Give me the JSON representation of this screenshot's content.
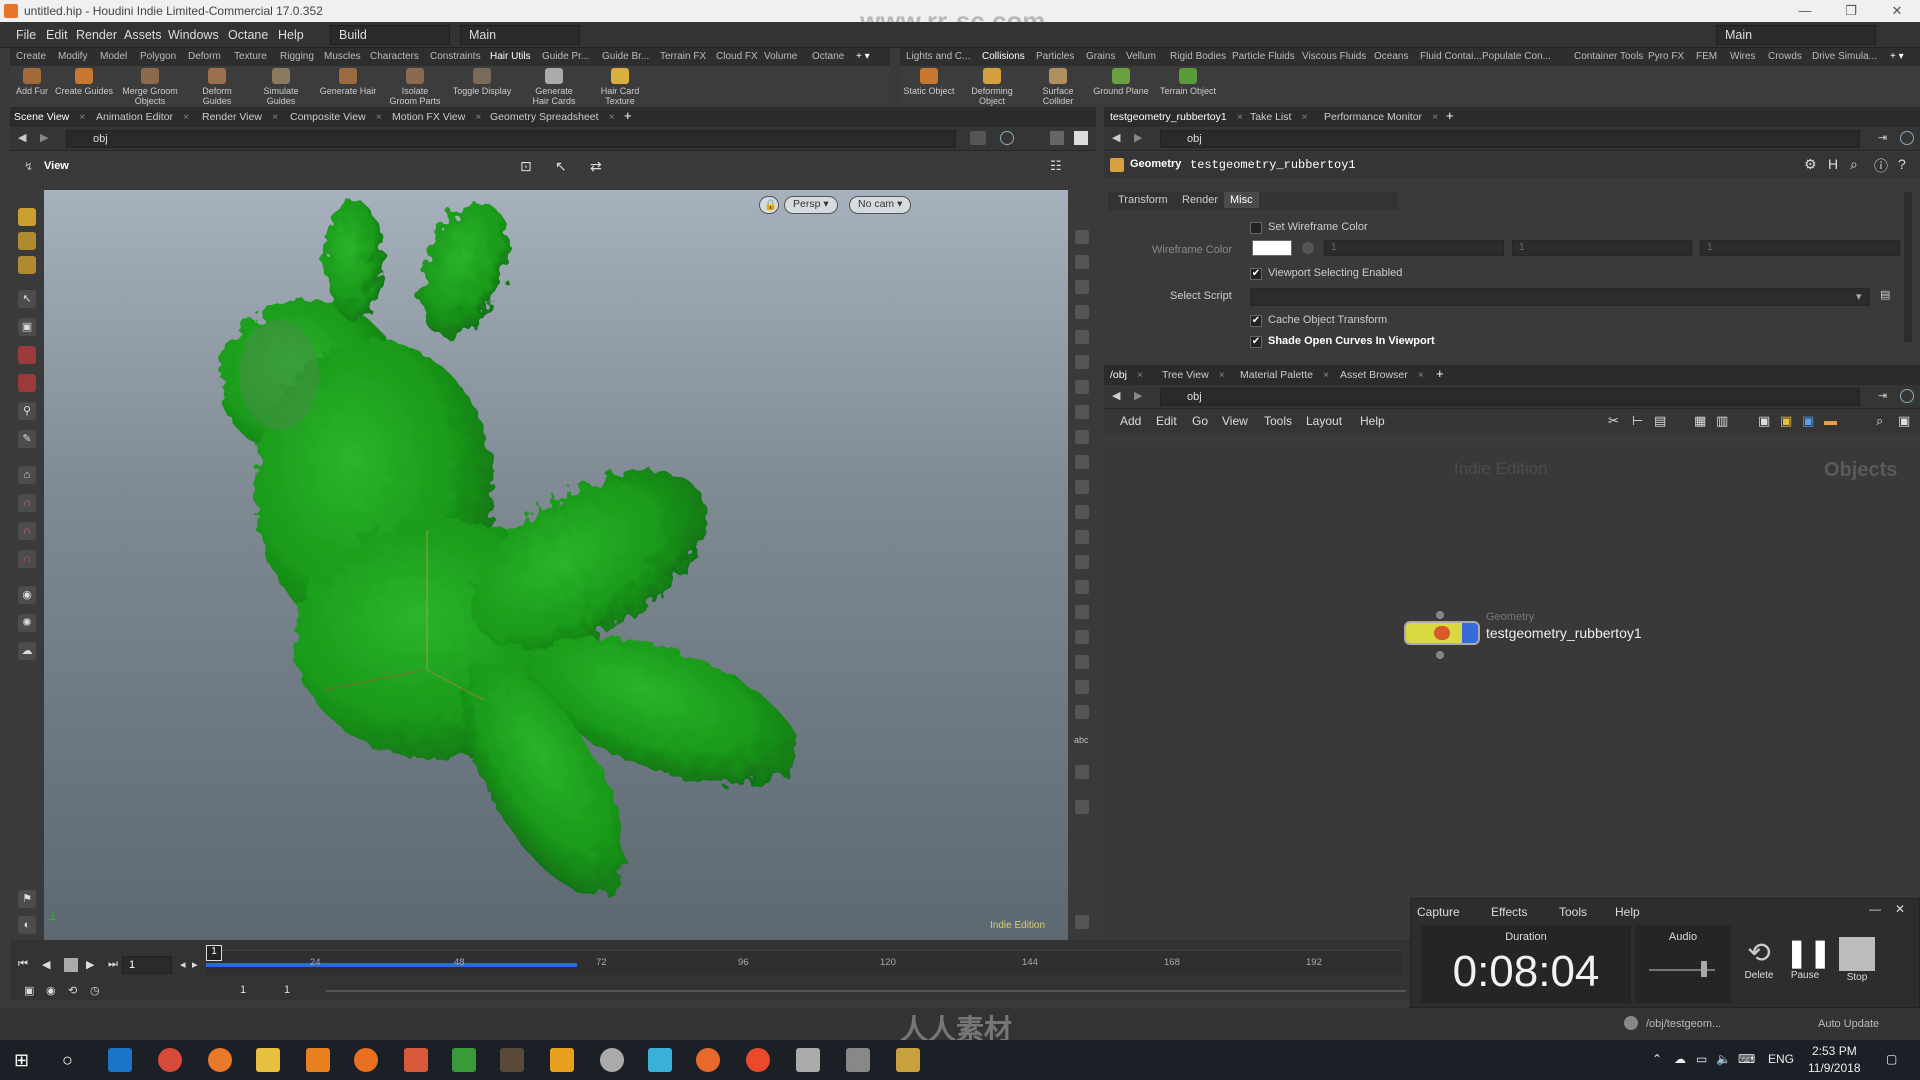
{
  "window": {
    "title": "untitled.hip - Houdini Indie Limited-Commercial 17.0.352"
  },
  "menu": {
    "items": [
      "File",
      "Edit",
      "Render",
      "Assets",
      "Windows",
      "Octane",
      "Help"
    ],
    "desktop": "Build",
    "context": "Main",
    "right_desktop": "Main"
  },
  "watermark": "www.rr-sc.com",
  "shelf_left": {
    "tabs": [
      "Create",
      "Modify",
      "Model",
      "Polygon",
      "Deform",
      "Texture",
      "Rigging",
      "Muscles",
      "Characters",
      "Constraints",
      "Hair Utils",
      "Guide Pr...",
      "Guide Br...",
      "Terrain FX",
      "Cloud FX",
      "Volume",
      "Octane"
    ],
    "active_tab": "Hair Utils",
    "tools": [
      "Add Fur",
      "Create Guides",
      "Merge Groom Objects",
      "Deform Guides",
      "Simulate Guides",
      "Generate Hair",
      "Isolate Groom Parts",
      "Toggle Display",
      "Generate Hair Cards",
      "Hair Card Texture"
    ]
  },
  "shelf_right": {
    "tabs": [
      "Lights and C...",
      "Collisions",
      "Particles",
      "Grains",
      "Vellum",
      "Rigid Bodies",
      "Particle Fluids",
      "Viscous Fluids",
      "Oceans",
      "Fluid Contai...",
      "Populate Con...",
      "Container Tools",
      "Pyro FX",
      "FEM",
      "Wires",
      "Crowds",
      "Drive Simula..."
    ],
    "active_tab": "Collisions",
    "tools": [
      "Static Object",
      "Deforming Object",
      "Surface Collider",
      "Ground Plane",
      "Terrain Object"
    ]
  },
  "left_pane": {
    "tabs": [
      "Scene View",
      "Animation Editor",
      "Render View",
      "Composite View",
      "Motion FX View",
      "Geometry Spreadsheet"
    ],
    "path": "obj",
    "view_label": "View",
    "persp": "Persp",
    "camera": "No cam",
    "edition_tag": "Indie Edition"
  },
  "param_pane": {
    "tabs": [
      "testgeometry_rubbertoy1",
      "Take List",
      "Performance Monitor"
    ],
    "path": "obj",
    "node_type": "Geometry",
    "node_name": "testgeometry_rubbertoy1",
    "sub_tabs": [
      "Transform",
      "Render",
      "Misc"
    ],
    "active_sub_tab": "Misc",
    "params": {
      "set_wireframe_color": "Set Wireframe Color",
      "wireframe_color": "Wireframe Color",
      "wireframe_value": "1",
      "viewport_selecting": "Viewport Selecting Enabled",
      "select_script": "Select Script",
      "cache_transform": "Cache Object Transform",
      "shade_open_curves": "Shade Open Curves In Viewport"
    },
    "checks": {
      "set_wireframe_color": false,
      "viewport_selecting": true,
      "cache_transform": true,
      "shade_open_curves": true
    }
  },
  "network_pane": {
    "tabs": [
      "/obj",
      "Tree View",
      "Material Palette",
      "Asset Browser"
    ],
    "path": "obj",
    "menu": [
      "Add",
      "Edit",
      "Go",
      "View",
      "Tools",
      "Layout",
      "Help"
    ],
    "edition_watermark": "Indie Edition",
    "context_label": "Objects",
    "node": {
      "type": "Geometry",
      "name": "testgeometry_rubbertoy1"
    }
  },
  "timeline": {
    "frame": "1",
    "ticks": [
      "1",
      "24",
      "48",
      "72",
      "96",
      "120",
      "144",
      "168",
      "192"
    ],
    "range_start": "1",
    "range_end": "1",
    "playback_fraction": 0.31
  },
  "status": {
    "path": "/obj/testgeom...",
    "update": "Auto Update"
  },
  "capture": {
    "menu": [
      "Capture",
      "Effects",
      "Tools",
      "Help"
    ],
    "duration_label": "Duration",
    "duration": "0:08:04",
    "audio_label": "Audio",
    "buttons": [
      "Delete",
      "Pause",
      "Stop"
    ]
  },
  "bottom_watermark": "人人素材",
  "taskbar": {
    "lang": "ENG",
    "time": "2:53 PM",
    "date": "11/9/2018"
  },
  "colors": {
    "fur": "#1f9a1f",
    "accent_blue": "#2a6bd8",
    "node_yellow": "#d8d840"
  }
}
